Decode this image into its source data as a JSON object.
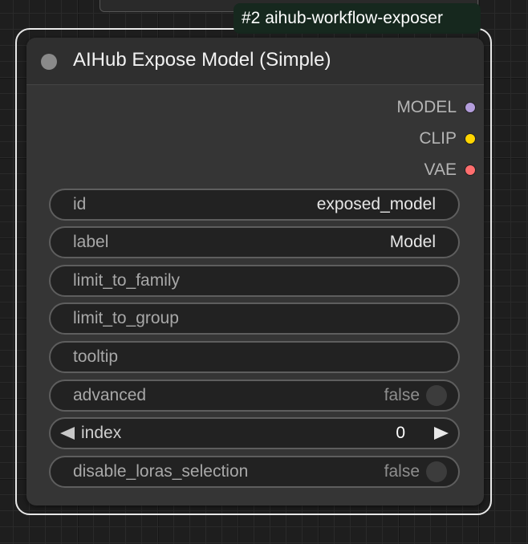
{
  "group": {
    "badge": "#2 aihub-workflow-exposer"
  },
  "node": {
    "title": "AIHub Expose Model (Simple)",
    "outputs": [
      {
        "label": "MODEL",
        "color": "#b39ddb"
      },
      {
        "label": "CLIP",
        "color": "#ffd500"
      },
      {
        "label": "VAE",
        "color": "#ff6e6e"
      }
    ],
    "widgets": {
      "id": {
        "label": "id",
        "value": "exposed_model"
      },
      "label": {
        "label": "label",
        "value": "Model"
      },
      "limit_to_family": {
        "label": "limit_to_family",
        "value": ""
      },
      "limit_to_group": {
        "label": "limit_to_group",
        "value": ""
      },
      "tooltip": {
        "label": "tooltip",
        "value": ""
      },
      "advanced": {
        "label": "advanced",
        "value": "false"
      },
      "index": {
        "label": "index",
        "value": "0"
      },
      "disable_loras_selection": {
        "label": "disable_loras_selection",
        "value": "false"
      }
    }
  },
  "icons": {
    "collapse": "circle-dot-icon",
    "decrement": "triangle-left-icon",
    "increment": "triangle-right-icon"
  },
  "colors": {
    "canvas": "#1e1e1e",
    "node_body": "#353535",
    "group_badge": "#16281e",
    "selection_outline": "#e8e8e8"
  }
}
